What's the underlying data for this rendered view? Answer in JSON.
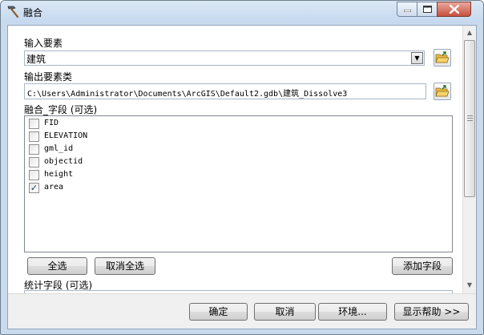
{
  "window": {
    "title": "融合",
    "title_icon": "hammer-tool-icon"
  },
  "title_buttons": [
    "minimize-icon",
    "maximize-icon",
    "close-icon"
  ],
  "form": {
    "input_features": {
      "label": "输入要素",
      "value": "建筑"
    },
    "output_features": {
      "label": "输出要素类",
      "value": "C:\\Users\\Administrator\\Documents\\ArcGIS\\Default2.gdb\\建筑_Dissolve3"
    },
    "dissolve_fields": {
      "label": "融合_字段 (可选)",
      "items": [
        {
          "label": "FID",
          "checked": false
        },
        {
          "label": "ELEVATION",
          "checked": false
        },
        {
          "label": "gml_id",
          "checked": false
        },
        {
          "label": "objectid",
          "checked": false
        },
        {
          "label": "height",
          "checked": false
        },
        {
          "label": "area",
          "checked": true
        }
      ],
      "select_all": "全选",
      "unselect_all": "取消全选",
      "add_field": "添加字段"
    },
    "statistics_fields": {
      "label": "统计字段 (可选)"
    }
  },
  "footer": {
    "ok": "确定",
    "cancel": "取消",
    "environments": "环境...",
    "show_help": "显示帮助 >>"
  },
  "colors": {
    "frame": "#c9daed",
    "panel": "#f0f0f0",
    "close_button": "#c7513e",
    "folder": "#e8b948"
  }
}
